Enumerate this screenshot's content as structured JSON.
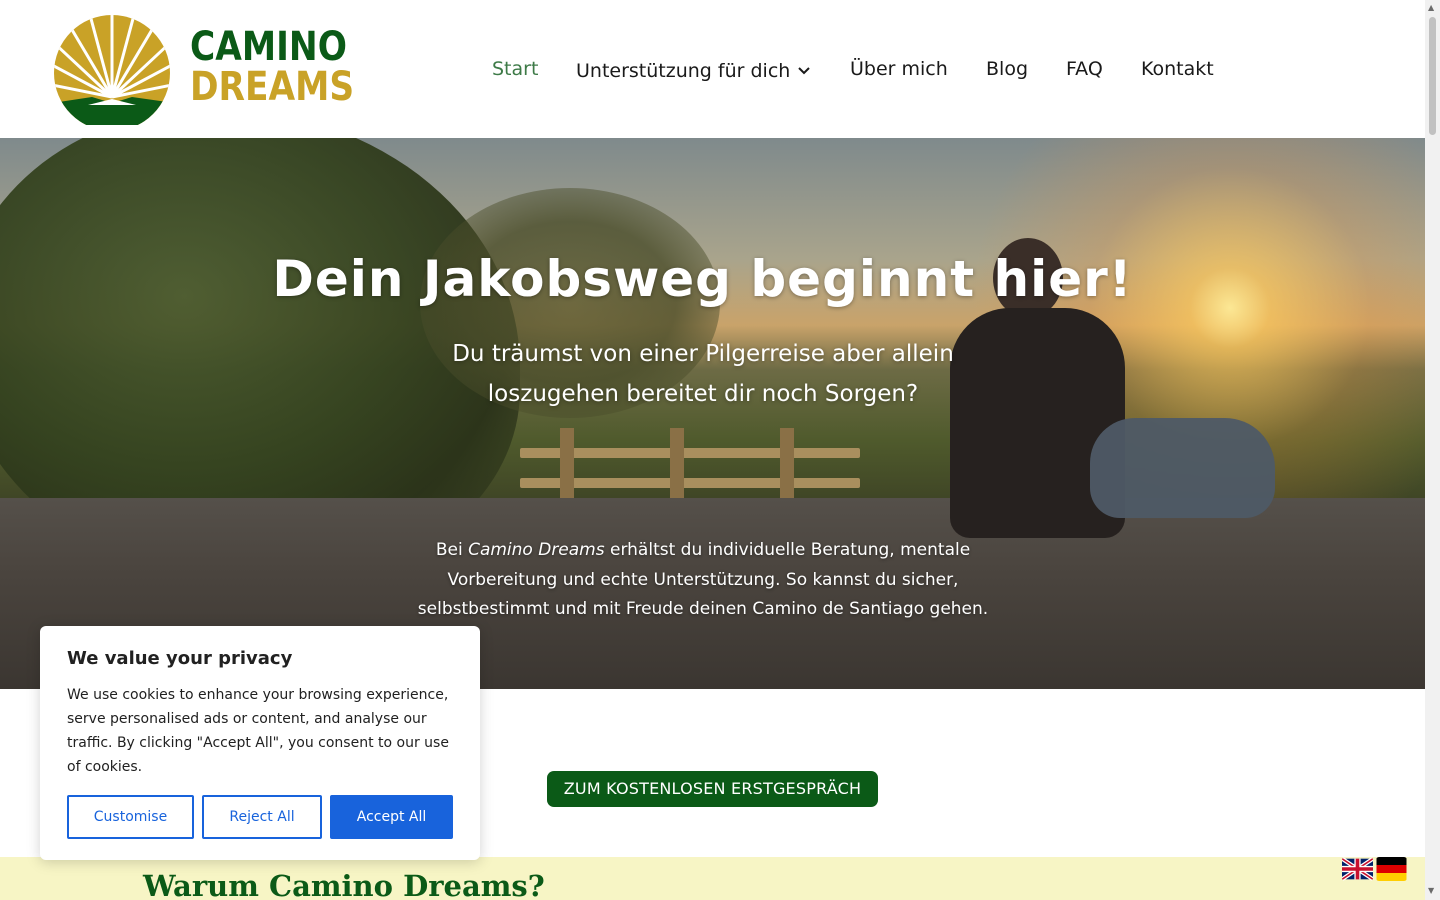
{
  "brand": {
    "line1": "CAMINO",
    "line2": "DREAMS",
    "colors": {
      "green": "#0b5a17",
      "gold": "#c9a227"
    }
  },
  "nav": {
    "items": [
      {
        "label": "Start",
        "active": true
      },
      {
        "label": "Unterstützung für dich",
        "has_dropdown": true
      },
      {
        "label": "Über mich"
      },
      {
        "label": "Blog"
      },
      {
        "label": "FAQ"
      },
      {
        "label": "Kontakt"
      }
    ]
  },
  "hero": {
    "title": "Dein Jakobsweg beginnt hier!",
    "subtitle": "Du träumst von einer Pilgerreise aber allein loszugehen bereitet dir noch Sorgen?",
    "body_prefix": "Bei ",
    "body_brand": "Camino Dreams",
    "body_rest": " erhältst du individuelle Beratung, mentale Vorbereitung und echte Unterstützung. So kannst du sicher, selbstbestimmt und mit Freude deinen Camino de Santiago gehen."
  },
  "cta": {
    "label": "ZUM KOSTENLOSEN ERSTGESPRÄCH"
  },
  "why": {
    "title": "Warum Camino Dreams?"
  },
  "flags": [
    {
      "name": "uk-flag-icon"
    },
    {
      "name": "germany-flag-icon"
    }
  ],
  "cookie": {
    "title": "We value your privacy",
    "text": "We use cookies to enhance your browsing experience, serve personalised ads or content, and analyse our traffic. By clicking \"Accept All\", you consent to our use of cookies.",
    "customise_label": "Customise",
    "reject_label": "Reject All",
    "accept_label": "Accept All",
    "accent_color": "#1863dc"
  }
}
